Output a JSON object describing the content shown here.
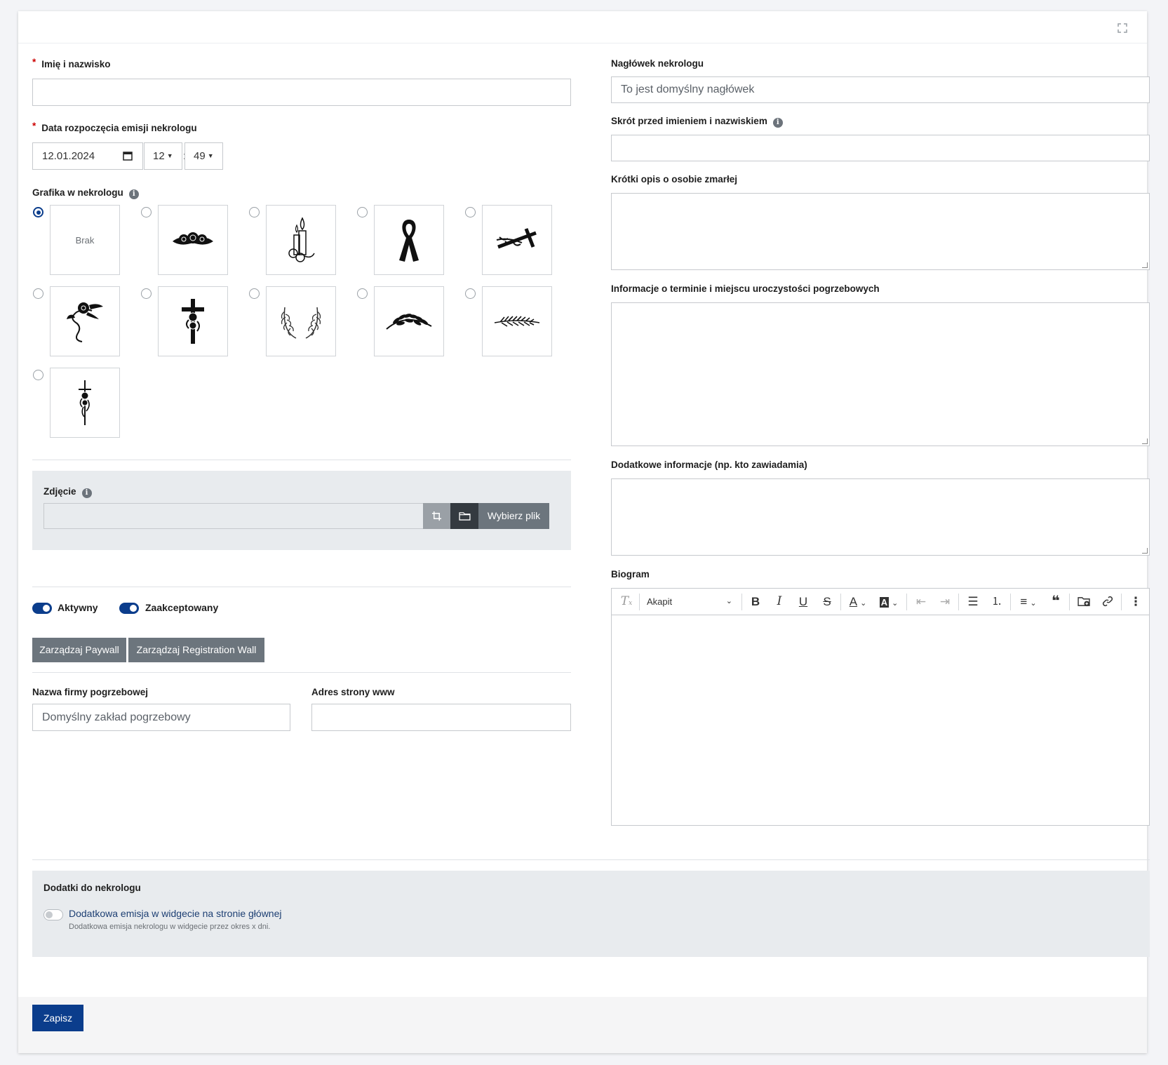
{
  "left": {
    "name_label": "Imię i nazwisko",
    "name_value": "",
    "date_label": "Data rozpoczęcia emisji nekrologu",
    "date_value": "12.01.2024",
    "hour_value": "12",
    "minute_value": "49",
    "time_sep": ":",
    "graphic_label": "Grafika w nekrologu",
    "graphic_none": "Brak",
    "graphics": [
      "none",
      "roses-icon",
      "candle-icon",
      "ribbon-icon",
      "cross-branch-icon",
      "rose-vine-icon",
      "rose-cross-icon",
      "wreath-icon",
      "wheat-icon",
      "palm-leaf-icon",
      "cross-rose-small-icon"
    ],
    "selected_graphic": 0,
    "photo_label": "Zdjęcie",
    "choose_file": "Wybierz plik",
    "active_label": "Aktywny",
    "accepted_label": "Zaakceptowany",
    "paywall_btn": "Zarządzaj Paywall",
    "regwall_btn": "Zarządzaj Registration Wall",
    "funeral_company_label": "Nazwa firmy pogrzebowej",
    "funeral_company_placeholder": "Domyślny zakład pogrzebowy",
    "website_label": "Adres strony www"
  },
  "right": {
    "header_label": "Nagłówek nekrologu",
    "header_placeholder": "To jest domyślny nagłówek",
    "abbrev_label": "Skrót przed imieniem i nazwiskiem",
    "short_desc_label": "Krótki opis o osobie zmarłej",
    "ceremony_label": "Informacje o terminie i miejscu uroczystości pogrzebowych",
    "additional_label": "Dodatkowe informacje (np. kto zawiadamia)",
    "biogram_label": "Biogram",
    "paragraph_select": "Akapit"
  },
  "addons": {
    "title": "Dodatki do nekrologu",
    "widget_label": "Dodatkowa emisja w widgecie na stronie głównej",
    "widget_help": "Dodatkowa emisja nekrologu w widgecie przez okres x dni."
  },
  "footer": {
    "save": "Zapisz"
  },
  "colors": {
    "primary": "#0b3d8c",
    "gray_btn": "#6c757d"
  }
}
